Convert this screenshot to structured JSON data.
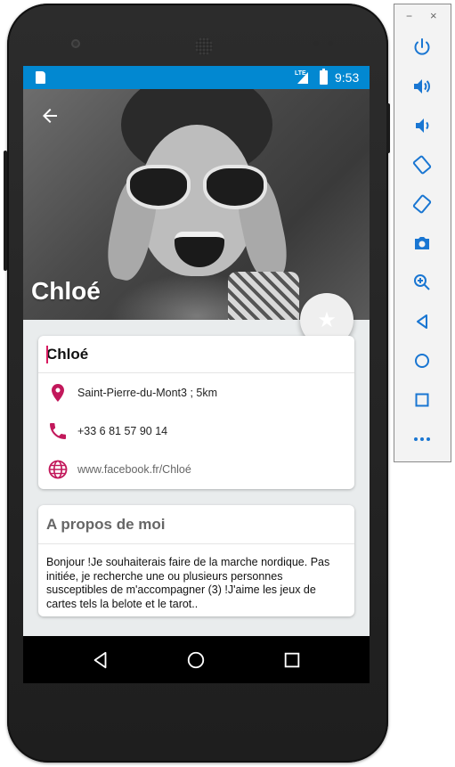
{
  "status_bar": {
    "network": "LTE",
    "time": "9:53"
  },
  "header": {
    "name": "Chloé"
  },
  "contact_card": {
    "name": "Chloé",
    "location": "Saint-Pierre-du-Mont3 ; 5km",
    "phone": "+33 6 81 57 90 14",
    "website": "www.facebook.fr/Chloé"
  },
  "about_card": {
    "title": "A propos de moi",
    "text": "Bonjour !Je souhaiterais faire de la marche nordique. Pas initiée, je recherche une ou plusieurs personnes susceptibles de m'accompagner (3) !J'aime les jeux de cartes tels la belote et le tarot.."
  },
  "colors": {
    "status_bar": "#0288d1",
    "accent": "#c2185b",
    "screen_bg": "#e9eced"
  },
  "emulator_toolbar": {
    "minimize": "−",
    "close": "×",
    "buttons": [
      "power-icon",
      "volume-up-icon",
      "volume-down-icon",
      "rotate-left-icon",
      "rotate-right-icon",
      "camera-icon",
      "zoom-icon",
      "back-icon",
      "home-icon",
      "overview-icon",
      "more-icon"
    ]
  }
}
